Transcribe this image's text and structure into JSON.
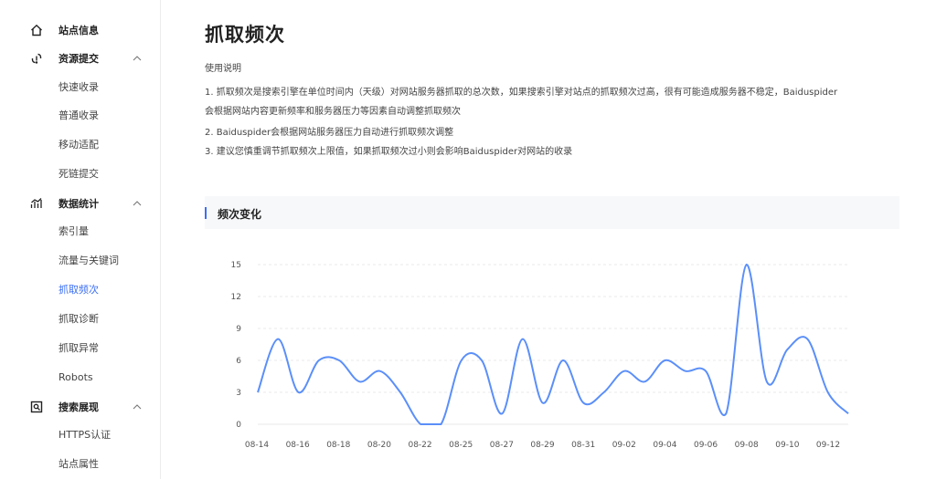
{
  "sidebar": {
    "groups": [
      {
        "label": "站点信息",
        "icon": "home-icon",
        "expandable": false,
        "items": []
      },
      {
        "label": "资源提交",
        "icon": "link-icon",
        "expandable": true,
        "items": [
          "快速收录",
          "普通收录",
          "移动适配",
          "死链提交"
        ]
      },
      {
        "label": "数据统计",
        "icon": "stats-icon",
        "expandable": true,
        "items": [
          "索引量",
          "流量与关键词",
          "抓取频次",
          "抓取诊断",
          "抓取异常",
          "Robots"
        ]
      },
      {
        "label": "搜索展现",
        "icon": "search-display-icon",
        "expandable": true,
        "items": [
          "HTTPS认证",
          "站点属性"
        ]
      }
    ],
    "active_item": "抓取频次"
  },
  "main": {
    "title": "抓取频次",
    "usage_title": "使用说明",
    "usage_lines": [
      "1. 抓取频次是搜索引擎在单位时间内（天级）对网站服务器抓取的总次数，如果搜索引擎对站点的抓取频次过高，很有可能造成服务器不稳定，Baiduspider",
      "会根据网站内容更新频率和服务器压力等因素自动调整抓取频次",
      "2. Baiduspider会根据网站服务器压力自动进行抓取频次调整",
      "3. 建议您慎重调节抓取频次上限值，如果抓取频次过小则会影响Baiduspider对网站的收录"
    ],
    "section_title": "频次变化"
  },
  "colors": {
    "accent": "#3b6ef6",
    "line": "#5b8ff9"
  },
  "chart_data": {
    "type": "line",
    "title": "",
    "xlabel": "",
    "ylabel": "",
    "ylim": [
      0,
      15
    ],
    "yticks": [
      0,
      3,
      6,
      9,
      12,
      15
    ],
    "x_tick_labels": [
      "08-14",
      "08-16",
      "08-18",
      "08-20",
      "08-22",
      "08-25",
      "08-27",
      "08-29",
      "08-31",
      "09-02",
      "09-04",
      "09-06",
      "09-08",
      "09-10",
      "09-12"
    ],
    "grid": true,
    "smooth": true,
    "points": [
      3,
      8,
      3,
      6,
      6,
      4,
      5,
      3,
      0,
      0,
      6,
      6,
      1,
      8,
      2,
      6,
      2,
      3,
      5,
      4,
      6,
      5,
      5,
      1,
      15,
      4,
      7,
      8,
      3,
      1
    ]
  }
}
